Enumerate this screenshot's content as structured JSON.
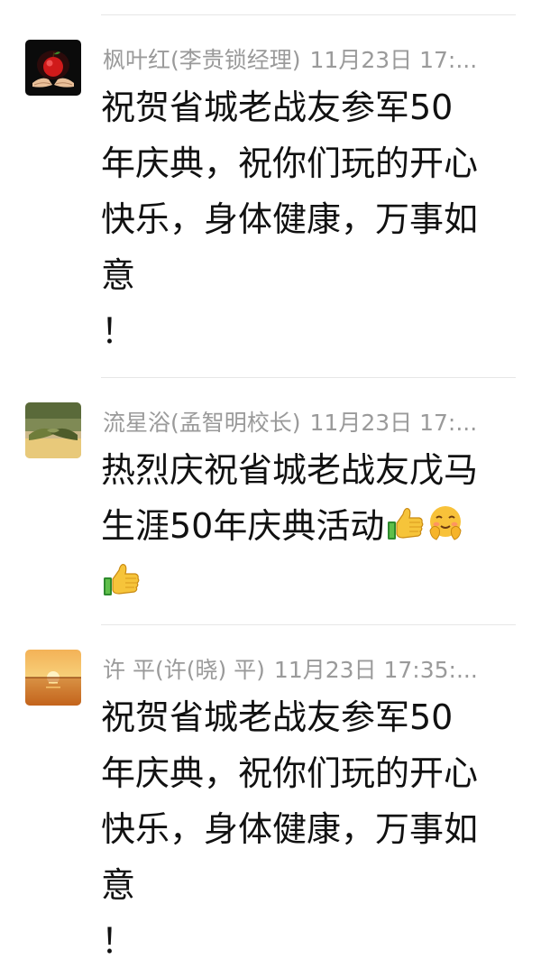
{
  "comments": [
    {
      "author": "枫叶红(李贵锁经理)",
      "time": "11月23日 17:...",
      "avatar_icon": "hands-holding-apple-avatar",
      "lines": [
        "祝贺省城老战友参军50",
        "年庆典，祝你们玩的开心",
        "快乐，身体健康，万事如",
        "意",
        "！"
      ]
    },
    {
      "author": "流星浴(孟智明校长)",
      "time": "11月23日 17:...",
      "avatar_icon": "handshake-avatar",
      "lines": [
        "热烈庆祝省城老战友戊马",
        "生涯50年庆典活动"
      ],
      "emojis": [
        "thumbs-up-emoji",
        "blushing-hug-emoji",
        "thumbs-up-emoji"
      ]
    },
    {
      "author": "许 平(许(晓) 平)",
      "time": "11月23日 17:35:...",
      "avatar_icon": "sunset-avatar",
      "lines": [
        "祝贺省城老战友参军50",
        "年庆典，祝你们玩的开心",
        "快乐，身体健康，万事如",
        "意",
        "！"
      ]
    }
  ],
  "colors": {
    "meta_text": "#9a9a9a",
    "body_text": "#111111",
    "divider": "#e6e6e6",
    "background": "#ffffff"
  }
}
